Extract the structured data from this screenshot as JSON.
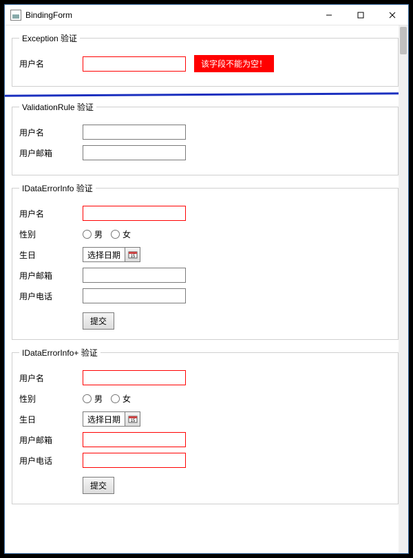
{
  "window": {
    "title": "BindingForm"
  },
  "section1": {
    "legend": "Exception 验证",
    "username_label": "用户名",
    "username_value": "",
    "error_text": "该字段不能为空！"
  },
  "section2": {
    "legend": "ValidationRule 验证",
    "username_label": "用户名",
    "username_value": "",
    "email_label": "用户邮箱",
    "email_value": ""
  },
  "section3": {
    "legend": "IDataErrorInfo 验证",
    "username_label": "用户名",
    "username_value": "",
    "gender_label": "性别",
    "gender_male": "男",
    "gender_female": "女",
    "birthday_label": "生日",
    "date_placeholder": "选择日期",
    "email_label": "用户邮箱",
    "email_value": "",
    "phone_label": "用户电话",
    "phone_value": "",
    "submit_label": "提交"
  },
  "section4": {
    "legend": "IDataErrorInfo+ 验证",
    "username_label": "用户名",
    "username_value": "",
    "gender_label": "性别",
    "gender_male": "男",
    "gender_female": "女",
    "birthday_label": "生日",
    "date_placeholder": "选择日期",
    "email_label": "用户邮箱",
    "email_value": "",
    "phone_label": "用户电话",
    "phone_value": "",
    "submit_label": "提交"
  }
}
